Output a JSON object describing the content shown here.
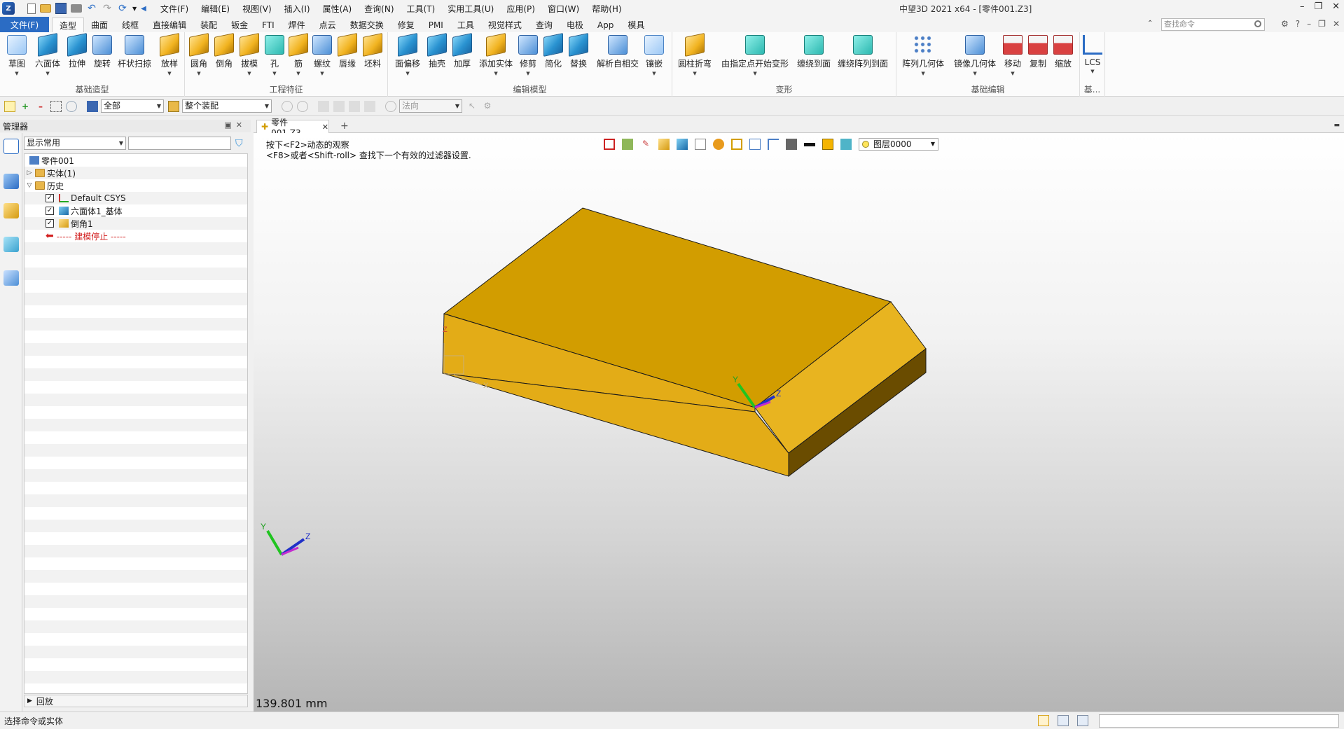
{
  "titlebar": {
    "app_title": "中望3D 2021 x64 - [零件001.Z3]",
    "menus": [
      "文件(F)",
      "编辑(E)",
      "视图(V)",
      "插入(I)",
      "属性(A)",
      "查询(N)",
      "工具(T)",
      "实用工具(U)",
      "应用(P)",
      "窗口(W)",
      "帮助(H)"
    ]
  },
  "ribbon_tabs": {
    "file": "文件(F)",
    "tabs": [
      "造型",
      "曲面",
      "线框",
      "直接编辑",
      "装配",
      "钣金",
      "FTI",
      "焊件",
      "点云",
      "数据交换",
      "修复",
      "PMI",
      "工具",
      "视觉样式",
      "查询",
      "电极",
      "App",
      "模具"
    ],
    "active": "造型",
    "search_placeholder": "查找命令"
  },
  "ribbon": {
    "groups": [
      {
        "label": "基础造型",
        "buttons": [
          "草图",
          "六面体",
          "拉伸",
          "旋转",
          "杆状扫掠",
          "放样"
        ]
      },
      {
        "label": "工程特征",
        "buttons": [
          "圆角",
          "倒角",
          "拔模",
          "孔",
          "筋",
          "螺纹",
          "唇缘",
          "坯料"
        ]
      },
      {
        "label": "编辑模型",
        "buttons": [
          "面偏移",
          "抽壳",
          "加厚",
          "添加实体",
          "修剪",
          "简化",
          "替换",
          "解析自相交",
          "镶嵌"
        ]
      },
      {
        "label": "变形",
        "buttons": [
          "圆柱折弯",
          "由指定点开始变形",
          "缠绕到面",
          "缠绕阵列到面"
        ]
      },
      {
        "label": "基础编辑",
        "buttons": [
          "阵列几何体",
          "镜像几何体",
          "移动",
          "复制",
          "缩放"
        ]
      },
      {
        "label": "基...",
        "buttons": [
          "LCS"
        ]
      }
    ]
  },
  "toolbar2": {
    "filter_value": "全部",
    "assembly_value": "整个装配",
    "direction_value": "法向"
  },
  "manager": {
    "title": "管理器",
    "display_combo": "显示常用",
    "tree": {
      "root": "零件001",
      "solid": "实体(1)",
      "history": "历史",
      "items": [
        "Default CSYS",
        "六面体1_基体",
        "倒角1"
      ],
      "stop": "----- 建模停止 -----"
    },
    "rollback": "回放"
  },
  "document": {
    "tab_label": "零件001.Z3",
    "hint_line1": "按下<F2>动态的观察",
    "hint_line2": "<F8>或者<Shift-roll> 查找下一个有效的过滤器设置.",
    "layer": "图层0000",
    "measure": "139.801 mm",
    "axis_labels": {
      "x": "X",
      "y": "Y",
      "z": "Z"
    }
  },
  "colors": {
    "part_top": "#d29d00",
    "part_front": "#e3ac17",
    "part_bevel": "#e8b420",
    "part_side": "#6a4c00",
    "accent": "#2b6cc4"
  },
  "statusbar": {
    "text": "选择命令或实体"
  }
}
